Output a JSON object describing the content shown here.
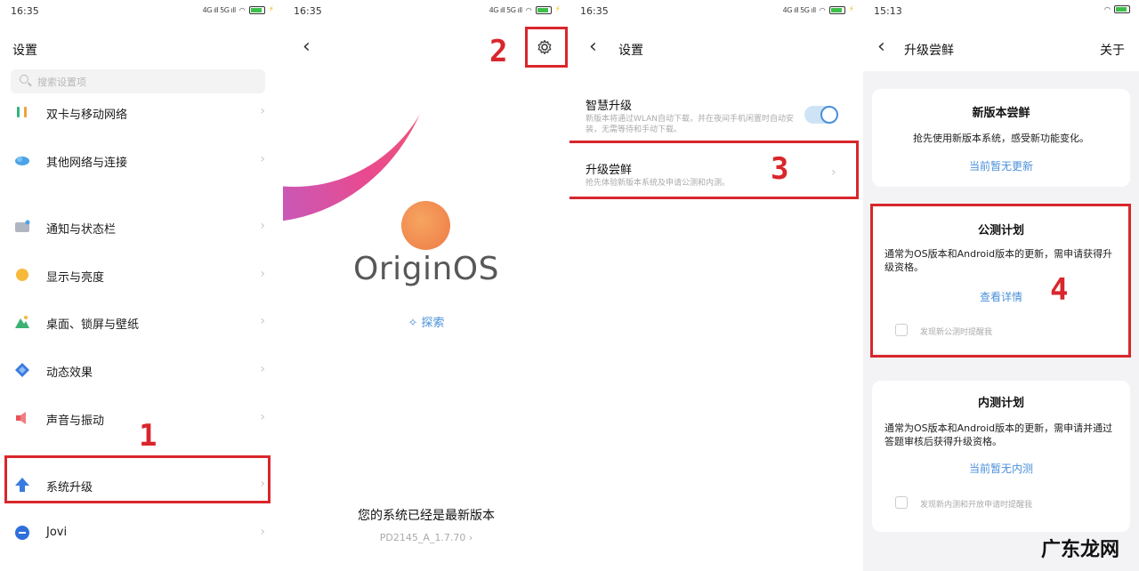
{
  "panel1": {
    "time": "16:35",
    "title": "设置",
    "search_placeholder": "搜索设置项",
    "items": [
      {
        "label": "双卡与移动网络",
        "icon": "sim-icon"
      },
      {
        "label": "其他网络与连接",
        "icon": "network-icon"
      },
      {
        "label": "通知与状态栏",
        "icon": "notification-icon"
      },
      {
        "label": "显示与亮度",
        "icon": "brightness-icon"
      },
      {
        "label": "桌面、锁屏与壁纸",
        "icon": "wallpaper-icon"
      },
      {
        "label": "动态效果",
        "icon": "animation-icon"
      },
      {
        "label": "声音与振动",
        "icon": "sound-icon"
      },
      {
        "label": "系统升级",
        "icon": "upgrade-icon"
      },
      {
        "label": "Jovi",
        "icon": "jovi-icon"
      }
    ],
    "annotation": "1"
  },
  "panel2": {
    "time": "16:35",
    "logo": "OriginOS",
    "explore": "探索",
    "status": "您的系统已经是最新版本",
    "version": "PD2145_A_1.7.70",
    "annotation": "2"
  },
  "panel3": {
    "time": "16:35",
    "title": "设置",
    "smart_upgrade": {
      "title": "智慧升级",
      "desc": "新版本将通过WLAN自动下载，并在夜间手机闲置时自动安装，无需等待和手动下载。",
      "enabled": true
    },
    "beta": {
      "title": "升级尝鲜",
      "desc": "抢先体验新版本系统及申请公测和内测。"
    },
    "annotation": "3"
  },
  "panel4": {
    "time": "15:13",
    "title": "升级尝鲜",
    "about": "关于",
    "card_new": {
      "title": "新版本尝鲜",
      "desc": "抢先使用新版本系统，感受新功能变化。",
      "link": "当前暂无更新"
    },
    "card_public": {
      "title": "公测计划",
      "desc": "通常为OS版本和Android版本的更新，需申请获得升级资格。",
      "link": "查看详情",
      "checkbox_label": "发现新公测时提醒我"
    },
    "card_internal": {
      "title": "内测计划",
      "desc": "通常为OS版本和Android版本的更新，需申请并通过答题审核后获得升级资格。",
      "link": "当前暂无内测",
      "checkbox_label": "发现新内测和开放申请时提醒我"
    },
    "annotation": "4",
    "watermark": "广东龙网"
  },
  "colors": {
    "annotation_red": "#d9262c",
    "link_blue": "#4a90d9"
  }
}
